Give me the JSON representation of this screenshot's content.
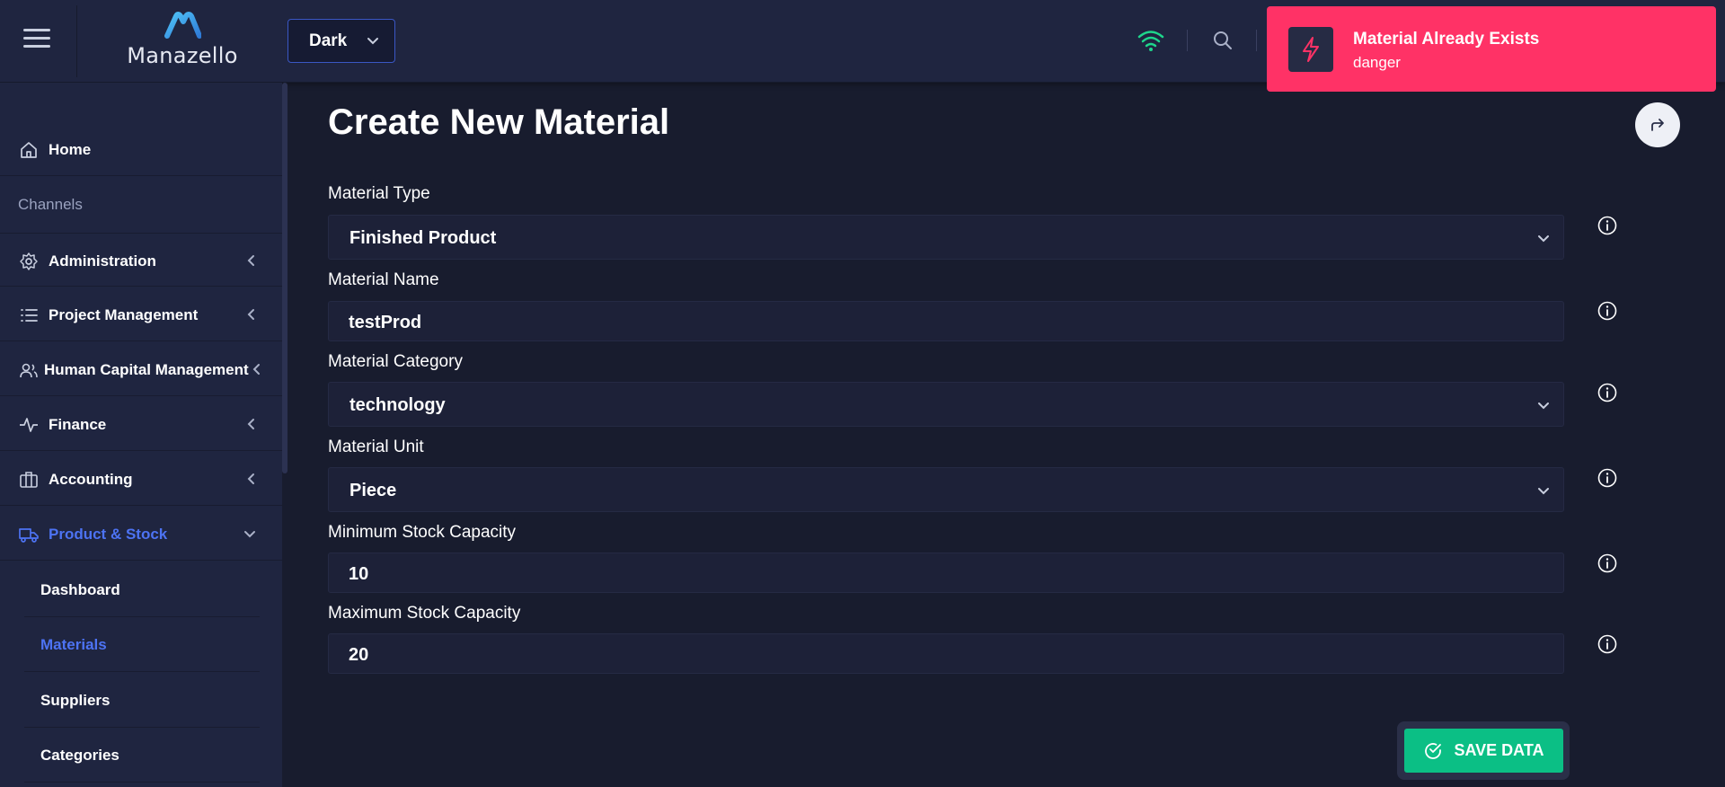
{
  "header": {
    "brand": "Manazello",
    "theme_select": {
      "value": "Dark"
    },
    "colors": {
      "accent": "#3a57c4",
      "wifi": "#1ed68c"
    }
  },
  "toast": {
    "title": "Material Already Exists",
    "subtitle": "danger",
    "color": "#ff3266"
  },
  "sidebar": {
    "home": "Home",
    "channels": "Channels",
    "items": [
      {
        "label": "Administration",
        "icon": "gear-icon"
      },
      {
        "label": "Project Management",
        "icon": "list-icon"
      },
      {
        "label": "Human Capital Management",
        "icon": "users-icon"
      },
      {
        "label": "Finance",
        "icon": "activity-icon"
      },
      {
        "label": "Accounting",
        "icon": "briefcase-icon"
      },
      {
        "label": "Product & Stock",
        "icon": "truck-icon"
      }
    ],
    "subitems": [
      {
        "label": "Dashboard"
      },
      {
        "label": "Materials"
      },
      {
        "label": "Suppliers"
      },
      {
        "label": "Categories"
      }
    ]
  },
  "main": {
    "title": "Create New Material",
    "fields": [
      {
        "label": "Material Type",
        "value": "Finished Product",
        "kind": "select"
      },
      {
        "label": "Material Name",
        "value": "testProd",
        "kind": "input"
      },
      {
        "label": "Material Category",
        "value": "technology",
        "kind": "select"
      },
      {
        "label": "Material Unit",
        "value": "Piece",
        "kind": "select"
      },
      {
        "label": "Minimum Stock Capacity",
        "value": "10",
        "kind": "input"
      },
      {
        "label": "Maximum Stock Capacity",
        "value": "20",
        "kind": "input"
      }
    ],
    "save_label": "SAVE DATA"
  }
}
